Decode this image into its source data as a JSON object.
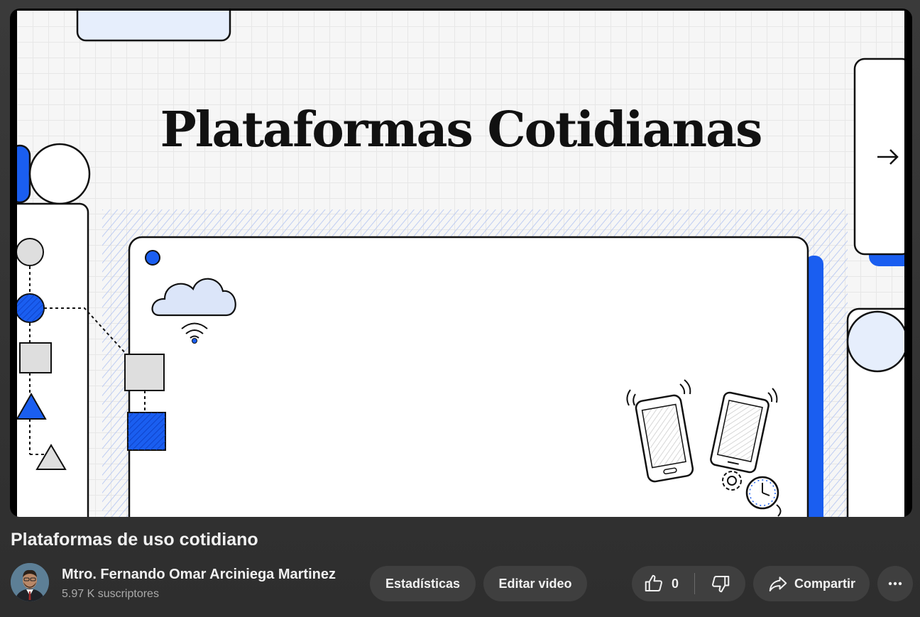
{
  "slide": {
    "title": "Plataformas Cotidianas"
  },
  "video": {
    "title": "Plataformas de uso cotidiano"
  },
  "channel": {
    "name": "Mtro. Fernando Omar Arciniega Martinez",
    "subscribers": "5.97 K suscriptores"
  },
  "actions": {
    "stats_label": "Estadísticas",
    "edit_label": "Editar video",
    "like_count": "0",
    "share_label": "Compartir"
  },
  "icons": {
    "like": "thumbs-up-icon",
    "dislike": "thumbs-down-icon",
    "share": "share-arrow-icon",
    "more": "more-horizontal-icon"
  },
  "colors": {
    "accent_blue": "#1a5ef0",
    "button_bg": "#3f3f3f",
    "background": "#2e2e2e"
  }
}
